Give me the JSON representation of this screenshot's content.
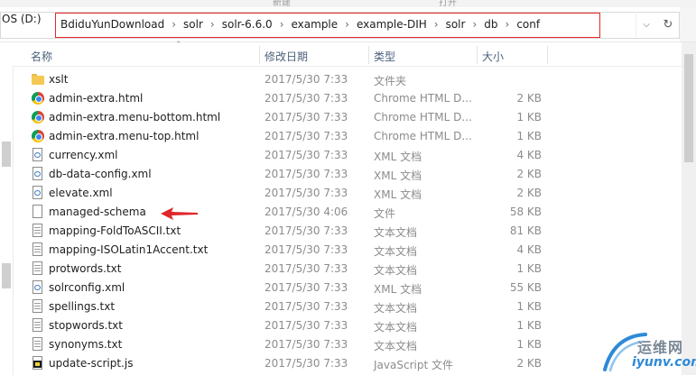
{
  "ribbon": {
    "label": "新建",
    "label2": "打开"
  },
  "address": {
    "drive": "OS (D:)",
    "crumbs": [
      "BdiduYunDownload",
      "solr",
      "solr-6.6.0",
      "example",
      "example-DIH",
      "solr",
      "db",
      "conf"
    ]
  },
  "columns": {
    "name": "名称",
    "date": "修改日期",
    "type": "类型",
    "size": "大小"
  },
  "files": [
    {
      "name": "xslt",
      "date": "2017/5/30 7:33",
      "type": "文件夹",
      "size": "",
      "icon": "folder-icon"
    },
    {
      "name": "admin-extra.html",
      "date": "2017/5/30 7:33",
      "type": "Chrome HTML D...",
      "size": "2 KB",
      "icon": "chrome-icon"
    },
    {
      "name": "admin-extra.menu-bottom.html",
      "date": "2017/5/30 7:33",
      "type": "Chrome HTML D...",
      "size": "1 KB",
      "icon": "chrome-icon"
    },
    {
      "name": "admin-extra.menu-top.html",
      "date": "2017/5/30 7:33",
      "type": "Chrome HTML D...",
      "size": "1 KB",
      "icon": "chrome-icon"
    },
    {
      "name": "currency.xml",
      "date": "2017/5/30 7:33",
      "type": "XML 文档",
      "size": "4 KB",
      "icon": "xml-icon"
    },
    {
      "name": "db-data-config.xml",
      "date": "2017/5/30 7:33",
      "type": "XML 文档",
      "size": "2 KB",
      "icon": "xml-icon"
    },
    {
      "name": "elevate.xml",
      "date": "2017/5/30 7:33",
      "type": "XML 文档",
      "size": "2 KB",
      "icon": "xml-icon"
    },
    {
      "name": "managed-schema",
      "date": "2017/5/30 4:06",
      "type": "文件",
      "size": "58 KB",
      "icon": "blank-icon"
    },
    {
      "name": "mapping-FoldToASCII.txt",
      "date": "2017/5/30 7:33",
      "type": "文本文档",
      "size": "81 KB",
      "icon": "txt-icon"
    },
    {
      "name": "mapping-ISOLatin1Accent.txt",
      "date": "2017/5/30 7:33",
      "type": "文本文档",
      "size": "4 KB",
      "icon": "txt-icon"
    },
    {
      "name": "protwords.txt",
      "date": "2017/5/30 7:33",
      "type": "文本文档",
      "size": "1 KB",
      "icon": "txt-icon"
    },
    {
      "name": "solrconfig.xml",
      "date": "2017/5/30 7:33",
      "type": "XML 文档",
      "size": "55 KB",
      "icon": "xml-icon"
    },
    {
      "name": "spellings.txt",
      "date": "2017/5/30 7:33",
      "type": "文本文档",
      "size": "1 KB",
      "icon": "txt-icon"
    },
    {
      "name": "stopwords.txt",
      "date": "2017/5/30 7:33",
      "type": "文本文档",
      "size": "1 KB",
      "icon": "txt-icon"
    },
    {
      "name": "synonyms.txt",
      "date": "2017/5/30 7:33",
      "type": "文本文档",
      "size": "1 KB",
      "icon": "txt-icon"
    },
    {
      "name": "update-script.js",
      "date": "2017/5/30 7:33",
      "type": "JavaScript 文件",
      "size": "2 KB",
      "icon": "js-icon"
    }
  ],
  "watermark": {
    "cn": "运维网",
    "en": "iyunv.com"
  },
  "colors": {
    "annotation": "#e0262a",
    "header_text": "#4c607a",
    "watermark_blue": "#2e8ad8"
  }
}
